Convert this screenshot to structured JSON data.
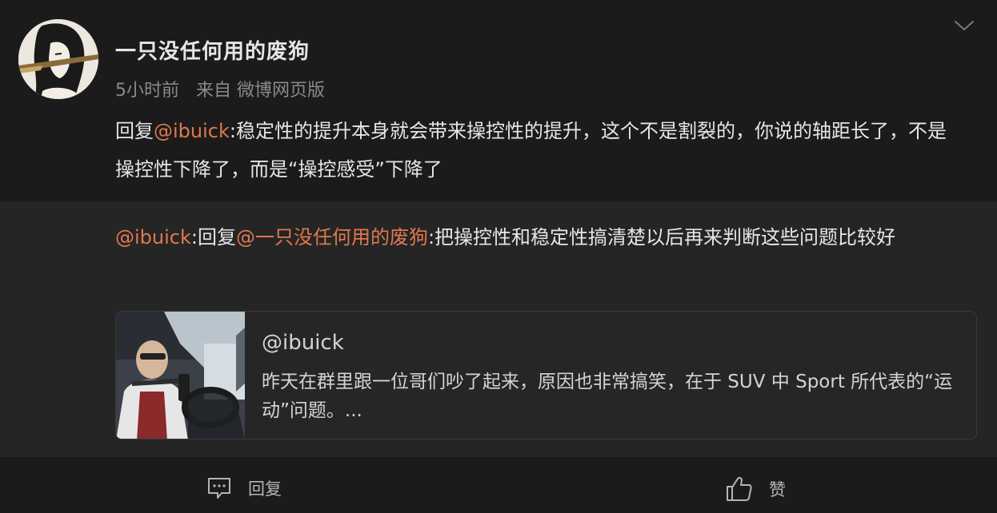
{
  "post": {
    "author": "一只没任何用的废狗",
    "time": "5小时前",
    "source": "来自 微博网页版",
    "reply_prefix": "回复",
    "reply_mention": "@ibuick",
    "body": ":稳定性的提升本身就会带来操控性的提升，这个不是割裂的，你说的轴距长了，不是操控性下降了，而是“操控感受”下降了"
  },
  "quoted_reply": {
    "author_mention": "@ibuick",
    "reply_word": ":回复",
    "target_mention": "@一只没任何用的废狗",
    "body": ":把操控性和稳定性搞清楚以后再来判断这些问题比较好"
  },
  "card": {
    "handle": "@ibuick",
    "description": "昨天在群里跟一位哥们吵了起来，原因也非常搞笑，在于 SUV 中 Sport 所代表的“运动”问题。..."
  },
  "actions": {
    "reply_label": "回复",
    "like_label": "赞"
  },
  "icons": {
    "more": "chevron-down-icon",
    "reply": "comment-icon",
    "like": "thumbs-up-icon"
  },
  "colors": {
    "background": "#1b1b1b",
    "quoted_background": "#252525",
    "mention": "#e0784f",
    "text": "#e6e6e6",
    "muted": "#8a8a8a"
  }
}
